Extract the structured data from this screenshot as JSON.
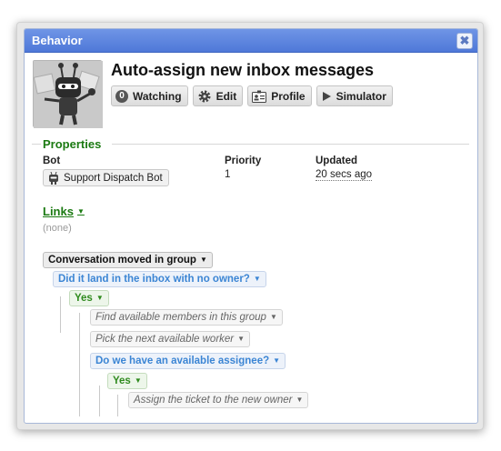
{
  "window": {
    "title": "Behavior",
    "close_icon": "close-icon"
  },
  "bot": {
    "name": "Auto-assign new inbox messages",
    "avatar_icon": "robot-avatar"
  },
  "actions": {
    "watching_count": "0",
    "watching_label": "Watching",
    "edit_label": "Edit",
    "profile_label": "Profile",
    "simulator_label": "Simulator"
  },
  "properties": {
    "heading": "Properties",
    "bot_label": "Bot",
    "bot_value": "Support Dispatch Bot",
    "priority_label": "Priority",
    "priority_value": "1",
    "updated_label": "Updated",
    "updated_value": "20 secs ago"
  },
  "links": {
    "heading": "Links",
    "empty_text": "(none)"
  },
  "flow": {
    "trigger": "Conversation moved in group",
    "condition_1": "Did it land in the inbox with no owner?",
    "yes_1": "Yes",
    "action_1": "Find available members in this group",
    "action_2": "Pick the next available worker",
    "condition_2": "Do we have an available assignee?",
    "yes_2": "Yes",
    "action_3": "Assign the ticket to the new owner"
  },
  "colors": {
    "title_bar": "#5a82de",
    "section_green": "#1b7a12",
    "condition_blue": "#3b85d4"
  }
}
